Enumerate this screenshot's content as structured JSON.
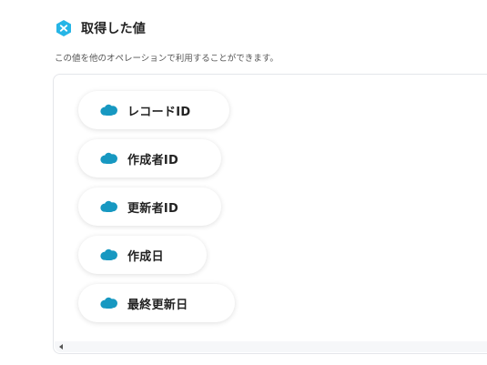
{
  "section": {
    "title": "取得した値",
    "description": "この値を他のオペレーションで利用することができます。",
    "icon": "yoom-hex-icon",
    "icon_color": "#26b5e6"
  },
  "values": [
    {
      "label": "レコードID",
      "icon": "salesforce-cloud-icon"
    },
    {
      "label": "作成者ID",
      "icon": "salesforce-cloud-icon"
    },
    {
      "label": "更新者ID",
      "icon": "salesforce-cloud-icon"
    },
    {
      "label": "作成日",
      "icon": "salesforce-cloud-icon"
    },
    {
      "label": "最終更新日",
      "icon": "salesforce-cloud-icon"
    }
  ],
  "colors": {
    "salesforce_blue": "#1798c1",
    "text": "#222222",
    "border": "#e4e6ea"
  }
}
